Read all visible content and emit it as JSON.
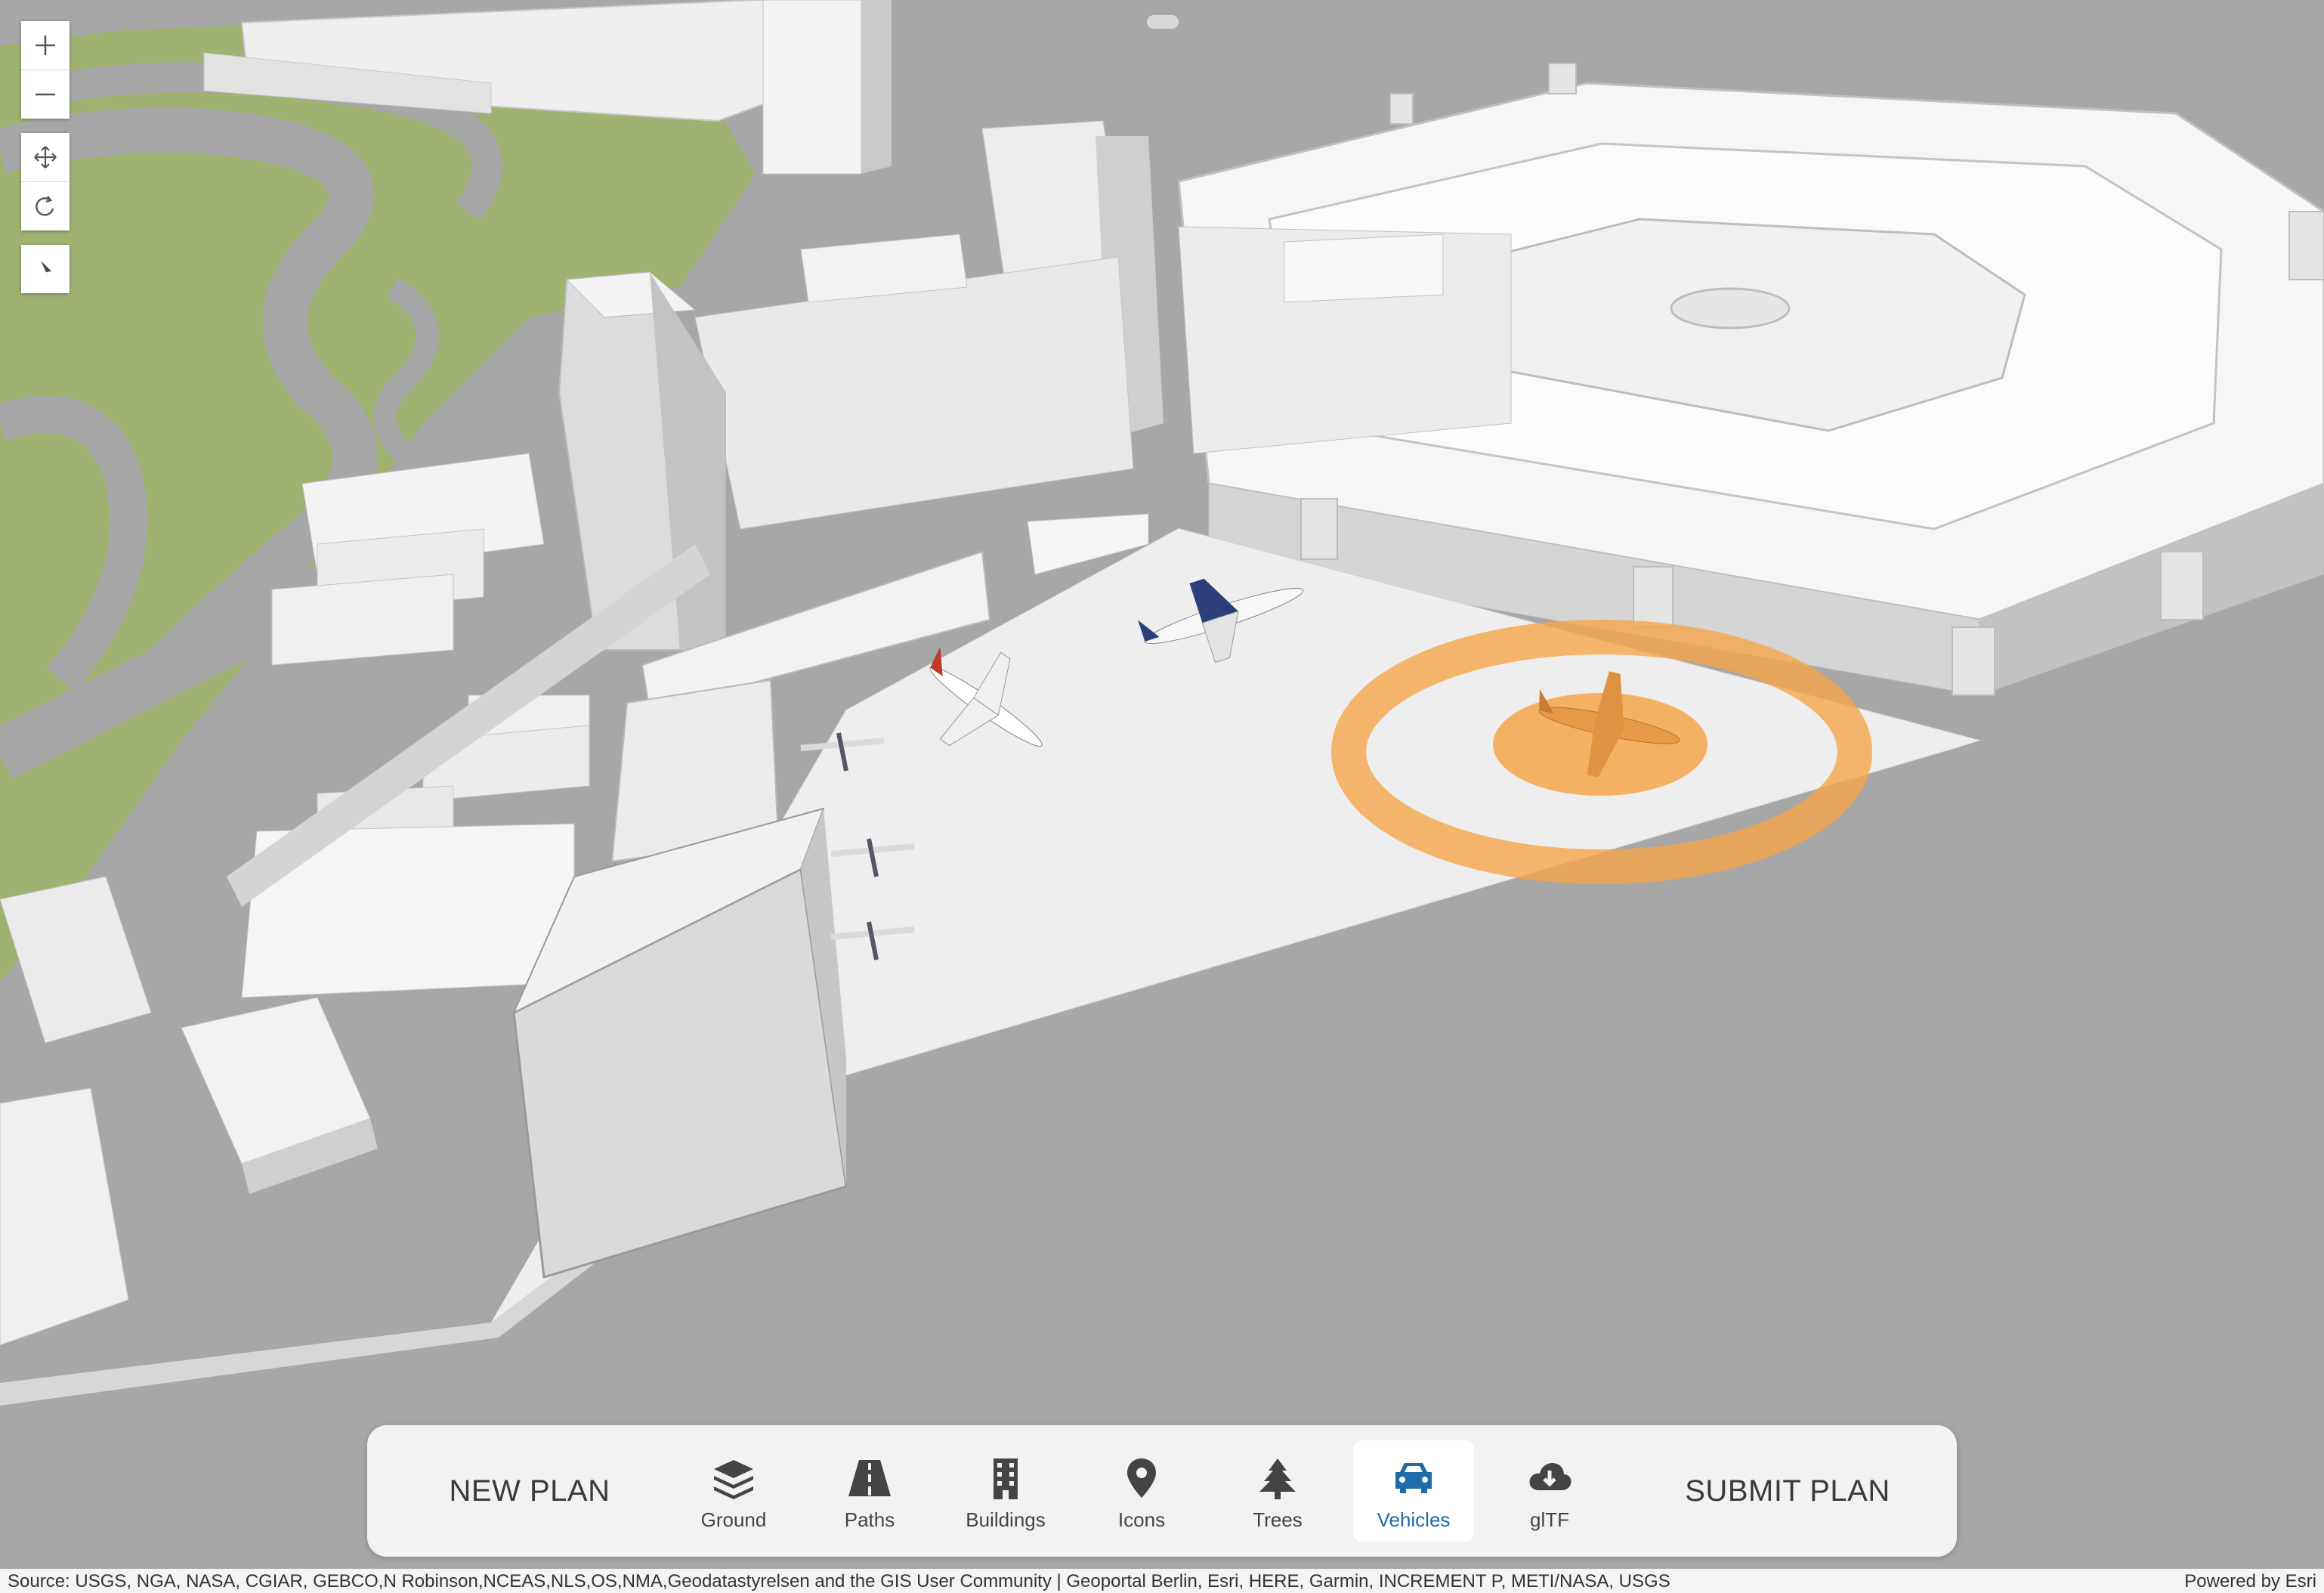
{
  "map": {
    "navigation": [
      {
        "name": "zoom-in-icon"
      },
      {
        "name": "zoom-out-icon"
      },
      {
        "name": "pan-icon"
      },
      {
        "name": "rotate-icon"
      },
      {
        "name": "compass-icon"
      }
    ],
    "selection_color": "#f5a54a",
    "ground_color": "#a6a7a6",
    "grass_color": "#9fb271"
  },
  "toolbar": {
    "new_plan": "NEW PLAN",
    "submit_plan": "SUBMIT PLAN",
    "items": [
      {
        "label": "Ground",
        "icon": "layers-icon",
        "active": false
      },
      {
        "label": "Paths",
        "icon": "road-icon",
        "active": false
      },
      {
        "label": "Buildings",
        "icon": "building-icon",
        "active": false
      },
      {
        "label": "Icons",
        "icon": "map-pin-icon",
        "active": false
      },
      {
        "label": "Trees",
        "icon": "tree-icon",
        "active": false
      },
      {
        "label": "Vehicles",
        "icon": "car-icon",
        "active": true
      },
      {
        "label": "glTF",
        "icon": "cloud-download-icon",
        "active": false
      }
    ],
    "accent_color": "#1f6aa8"
  },
  "attribution": {
    "source": "Source: USGS, NGA, NASA, CGIAR, GEBCO,N Robinson,NCEAS,NLS,OS,NMA,Geodatastyrelsen and the GIS User Community | Geoportal Berlin, Esri, HERE, Garmin, INCREMENT P, METI/NASA, USGS",
    "powered_by": "Powered by Esri"
  }
}
